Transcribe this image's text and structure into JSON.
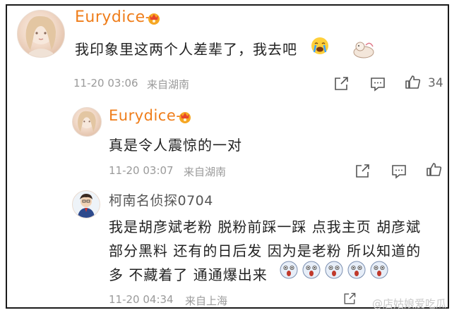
{
  "comments": [
    {
      "username": "Eurydice-",
      "text": "我印象里这两个人差辈了，我去吧",
      "time": "11-20 03:06",
      "location": "来自湖南",
      "likes": "34"
    },
    {
      "username": "Eurydice-",
      "text": "真是令人震惊的一对",
      "time": "11-20 03:07",
      "location": "来自湖南",
      "likes": ""
    },
    {
      "username": "柯南名侦探0704",
      "lines": [
        "我是胡彦斌老粉 脱粉前踩一踩 点我主页 胡彦斌",
        "部分黑料 还有的日后发 因为是老粉 所以知道的",
        "多 不藏着了 通通爆出来"
      ],
      "time": "11-20 04:34",
      "location": "来自上海",
      "likes": ""
    }
  ],
  "watermark": "@店姑娘爱吃瓜",
  "colors": {
    "username": "#ef7d1a",
    "meta": "#9a9a9a",
    "text": "#222222"
  },
  "icons": [
    "share-icon",
    "comment-icon",
    "like-icon",
    "vip-crown-badge-icon",
    "crying-emoji-icon",
    "scream-emoji-icon"
  ]
}
